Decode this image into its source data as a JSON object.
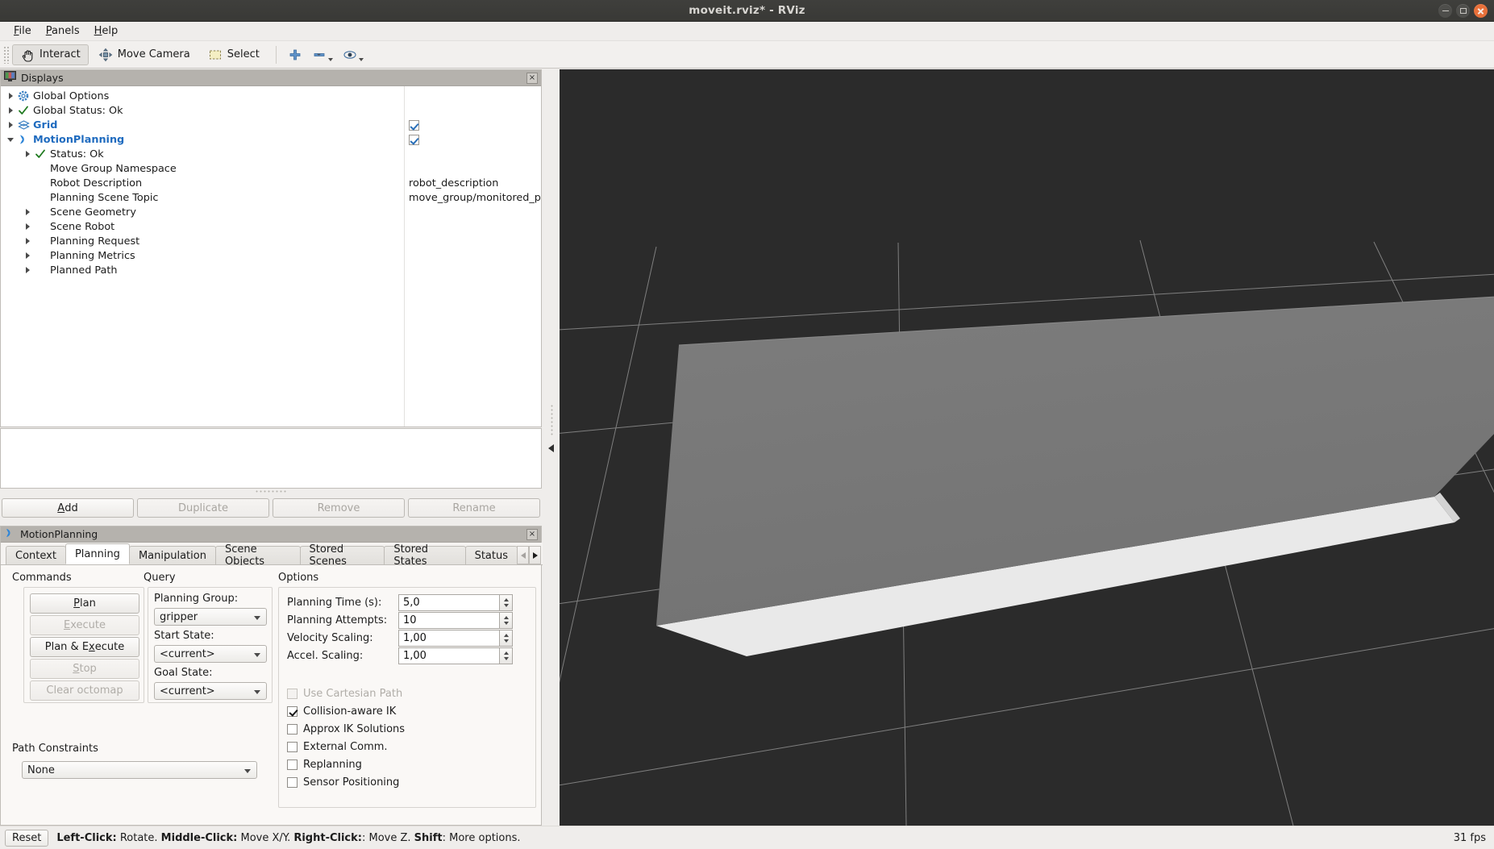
{
  "window": {
    "title": "moveit.rviz* - RViz",
    "controls": {
      "minimize": "minimize-button",
      "maximize": "maximize-button",
      "close": "close-button"
    }
  },
  "menubar": {
    "items": [
      "File",
      "Panels",
      "Help"
    ]
  },
  "toolbar": {
    "items": [
      {
        "label": "Interact",
        "icon": "hand-cursor-icon",
        "active": true
      },
      {
        "label": "Move Camera",
        "icon": "move-camera-icon",
        "active": false
      },
      {
        "label": "Select",
        "icon": "selection-rectangle-icon",
        "active": false
      }
    ],
    "extra": [
      {
        "icon": "plus-icon",
        "label": ""
      },
      {
        "icon": "minus-icon",
        "label": ""
      },
      {
        "icon": "focus-camera-icon",
        "label": ""
      }
    ]
  },
  "displays": {
    "header": "Displays",
    "icon": "displays-monitor-icon",
    "close_label": "×",
    "tree": [
      {
        "label": "Global Options",
        "indent": 0,
        "arrow": "closed",
        "icon": "gear-icon",
        "value": "",
        "check": null,
        "style": "normal"
      },
      {
        "label": "Global Status: Ok",
        "indent": 0,
        "arrow": "closed",
        "icon": "check-icon",
        "value": "",
        "check": null,
        "style": "normal"
      },
      {
        "label": "Grid",
        "indent": 0,
        "arrow": "closed",
        "icon": "grid-icon",
        "value": "",
        "check": true,
        "style": "bluebold"
      },
      {
        "label": "MotionPlanning",
        "indent": 0,
        "arrow": "open",
        "icon": "motionplanning-icon",
        "value": "",
        "check": true,
        "style": "bluebold"
      },
      {
        "label": "Status: Ok",
        "indent": 1,
        "arrow": "closed",
        "icon": "check-icon",
        "value": "",
        "check": null,
        "style": "normal"
      },
      {
        "label": "Move Group Namespace",
        "indent": 1,
        "arrow": "none",
        "icon": "none",
        "value": "",
        "check": null,
        "style": "normal"
      },
      {
        "label": "Robot Description",
        "indent": 1,
        "arrow": "none",
        "icon": "none",
        "value": "robot_description",
        "check": null,
        "style": "normal"
      },
      {
        "label": "Planning Scene Topic",
        "indent": 1,
        "arrow": "none",
        "icon": "none",
        "value": "move_group/monitored_p...",
        "check": null,
        "style": "normal"
      },
      {
        "label": "Scene Geometry",
        "indent": 1,
        "arrow": "closed",
        "icon": "none",
        "value": "",
        "check": null,
        "style": "normal"
      },
      {
        "label": "Scene Robot",
        "indent": 1,
        "arrow": "closed",
        "icon": "none",
        "value": "",
        "check": null,
        "style": "normal"
      },
      {
        "label": "Planning Request",
        "indent": 1,
        "arrow": "closed",
        "icon": "none",
        "value": "",
        "check": null,
        "style": "normal"
      },
      {
        "label": "Planning Metrics",
        "indent": 1,
        "arrow": "closed",
        "icon": "none",
        "value": "",
        "check": null,
        "style": "normal"
      },
      {
        "label": "Planned Path",
        "indent": 1,
        "arrow": "closed",
        "icon": "none",
        "value": "",
        "check": null,
        "style": "normal"
      }
    ],
    "buttons": [
      {
        "label": "Add",
        "underline": "A",
        "enabled": true
      },
      {
        "label": "Duplicate",
        "underline": "",
        "enabled": false
      },
      {
        "label": "Remove",
        "underline": "",
        "enabled": false
      },
      {
        "label": "Rename",
        "underline": "",
        "enabled": false
      }
    ]
  },
  "motion_planning": {
    "header": "MotionPlanning",
    "icon": "motionplanning-icon",
    "close_label": "×",
    "tabs": [
      {
        "label": "Context",
        "selected": false
      },
      {
        "label": "Planning",
        "selected": true
      },
      {
        "label": "Manipulation",
        "selected": false
      },
      {
        "label": "Scene Objects",
        "selected": false
      },
      {
        "label": "Stored Scenes",
        "selected": false
      },
      {
        "label": "Stored States",
        "selected": false
      },
      {
        "label": "Status",
        "selected": false
      }
    ],
    "commands": {
      "title": "Commands",
      "buttons": [
        {
          "label": "Plan",
          "enabled": true,
          "mnemonic_index": 1
        },
        {
          "label": "Execute",
          "enabled": false,
          "mnemonic_index": 0
        },
        {
          "label": "Plan & Execute",
          "enabled": true,
          "mnemonic_index": 8
        },
        {
          "label": "Stop",
          "enabled": false,
          "mnemonic_index": 0
        },
        {
          "label": "Clear octomap",
          "enabled": false,
          "mnemonic_index": -1
        }
      ]
    },
    "query": {
      "title": "Query",
      "fields": [
        {
          "label": "Planning Group:",
          "value": "gripper"
        },
        {
          "label": "Start State:",
          "value": "<current>"
        },
        {
          "label": "Goal State:",
          "value": "<current>"
        }
      ]
    },
    "path_constraints": {
      "title": "Path Constraints",
      "value": "None"
    },
    "options": {
      "title": "Options",
      "spinners": [
        {
          "label": "Planning Time (s):",
          "value": "5,0"
        },
        {
          "label": "Planning Attempts:",
          "value": "10"
        },
        {
          "label": "Velocity Scaling:",
          "value": "1,00"
        },
        {
          "label": "Accel. Scaling:",
          "value": "1,00"
        }
      ],
      "checkboxes": [
        {
          "label": "Use Cartesian Path",
          "checked": false,
          "enabled": false
        },
        {
          "label": "Collision-aware IK",
          "checked": true,
          "enabled": true
        },
        {
          "label": "Approx IK Solutions",
          "checked": false,
          "enabled": true
        },
        {
          "label": "External Comm.",
          "checked": false,
          "enabled": true
        },
        {
          "label": "Replanning",
          "checked": false,
          "enabled": true
        },
        {
          "label": "Sensor Positioning",
          "checked": false,
          "enabled": true
        }
      ]
    }
  },
  "viewport": {
    "name": "rviz-3d-view",
    "background_color": "#2b2b2b",
    "grid_line_color": "#8f8f8f",
    "floor_top_color": "#787878",
    "floor_edge_color": "#e8e8e8",
    "robot_body_color": "#2e3236",
    "robot_joint_color": "#4a7793"
  },
  "statusbar": {
    "reset_label": "Reset",
    "hint_parts": [
      {
        "text": "Left-Click:",
        "bold": true
      },
      {
        "text": " Rotate. ",
        "bold": false
      },
      {
        "text": "Middle-Click:",
        "bold": true
      },
      {
        "text": " Move X/Y. ",
        "bold": false
      },
      {
        "text": "Right-Click:",
        "bold": true
      },
      {
        "text": ": Move Z. ",
        "bold": false
      },
      {
        "text": "Shift",
        "bold": true
      },
      {
        "text": ": More options.",
        "bold": false
      }
    ],
    "fps": "31 fps"
  }
}
